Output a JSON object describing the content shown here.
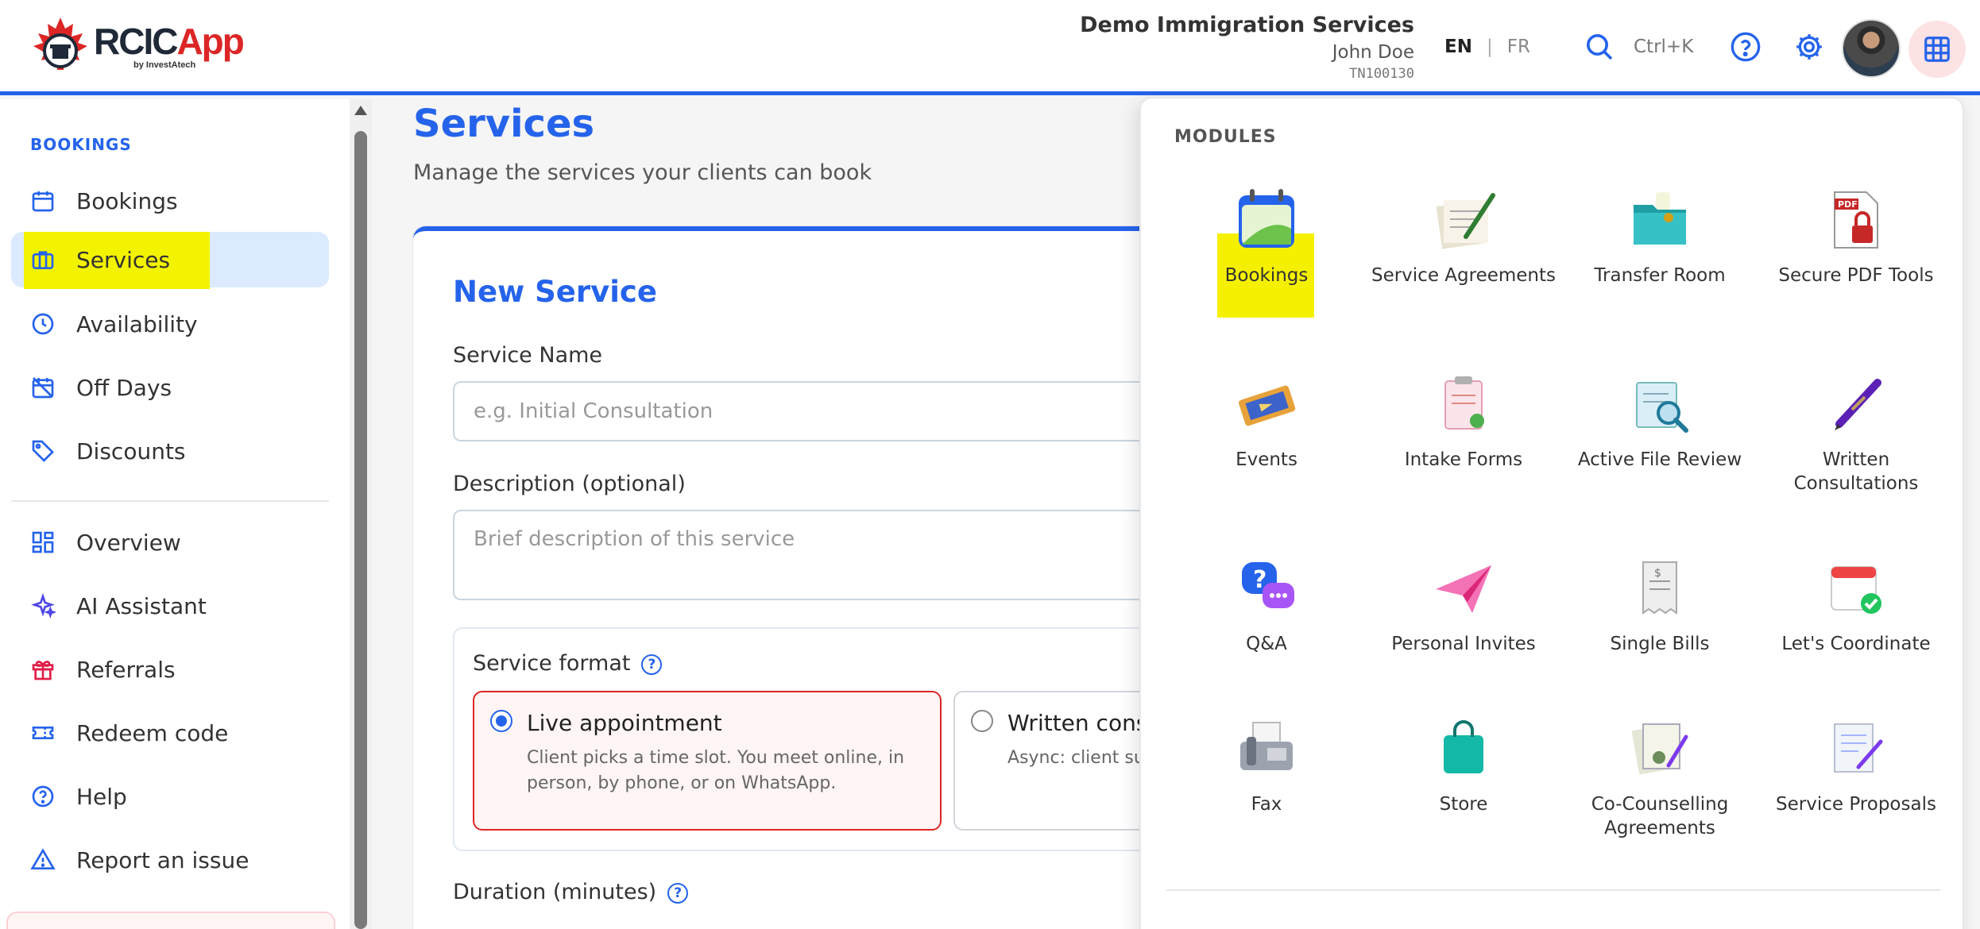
{
  "header": {
    "logo_title_1": "RCIC",
    "logo_title_2": "App",
    "logo_sub": "by InvestAtech",
    "company": "Demo Immigration Services",
    "user": "John Doe",
    "user_id": "TN100130",
    "lang_en": "EN",
    "lang_sep": "|",
    "lang_fr": "FR",
    "shortcut": "Ctrl+K"
  },
  "sidebar": {
    "section": "BOOKINGS",
    "items": [
      {
        "label": "Bookings",
        "icon": "calendar-icon"
      },
      {
        "label": "Services",
        "icon": "briefcase-icon"
      },
      {
        "label": "Availability",
        "icon": "clock-icon"
      },
      {
        "label": "Off Days",
        "icon": "calendar-off-icon"
      },
      {
        "label": "Discounts",
        "icon": "tag-icon"
      },
      {
        "label": "Overview",
        "icon": "dashboard-icon"
      },
      {
        "label": "AI Assistant",
        "icon": "sparkle-icon"
      },
      {
        "label": "Referrals",
        "icon": "gift-icon"
      },
      {
        "label": "Redeem code",
        "icon": "ticket-icon"
      },
      {
        "label": "Help",
        "icon": "help-circle-icon"
      },
      {
        "label": "Report an issue",
        "icon": "warning-icon"
      }
    ]
  },
  "main": {
    "title": "Services",
    "subtitle": "Manage the services your clients can book",
    "form": {
      "title": "New Service",
      "name_label": "Service Name",
      "name_placeholder": "e.g. Initial Consultation",
      "desc_label": "Description (optional)",
      "desc_placeholder": "Brief description of this service",
      "format_label": "Service format",
      "live_title": "Live appointment",
      "live_desc": "Client picks a time slot. You meet online, in person, by phone, or on WhatsApp.",
      "written_title": "Written cons",
      "written_desc": "Async: client su in a portal; you",
      "duration_label": "Duration (minutes)",
      "help_glyph": "?"
    }
  },
  "modules": {
    "heading": "MODULES",
    "items": [
      {
        "label": "Bookings",
        "icon": "bookings-calendar-icon"
      },
      {
        "label": "Service Agreements",
        "icon": "document-pen-icon"
      },
      {
        "label": "Transfer Room",
        "icon": "folder-icon"
      },
      {
        "label": "Secure PDF Tools",
        "icon": "pdf-lock-icon"
      },
      {
        "label": "Events",
        "icon": "ticket-icon"
      },
      {
        "label": "Intake Forms",
        "icon": "clipboard-icon"
      },
      {
        "label": "Active File Review",
        "icon": "file-search-icon"
      },
      {
        "label": "Written Consultations",
        "icon": "fountain-pen-icon"
      },
      {
        "label": "Q&A",
        "icon": "question-bubble-icon"
      },
      {
        "label": "Personal Invites",
        "icon": "paper-plane-icon"
      },
      {
        "label": "Single Bills",
        "icon": "receipt-icon"
      },
      {
        "label": "Let's Coordinate",
        "icon": "calendar-check-icon"
      },
      {
        "label": "Fax",
        "icon": "fax-icon"
      },
      {
        "label": "Store",
        "icon": "shopping-bag-icon"
      },
      {
        "label": "Co-Counselling Agreements",
        "icon": "documents-icon"
      },
      {
        "label": "Service Proposals",
        "icon": "proposal-icon"
      }
    ]
  },
  "colors": {
    "accent": "#2563eb",
    "highlight": "#f3f300",
    "danger": "#dc2626"
  }
}
